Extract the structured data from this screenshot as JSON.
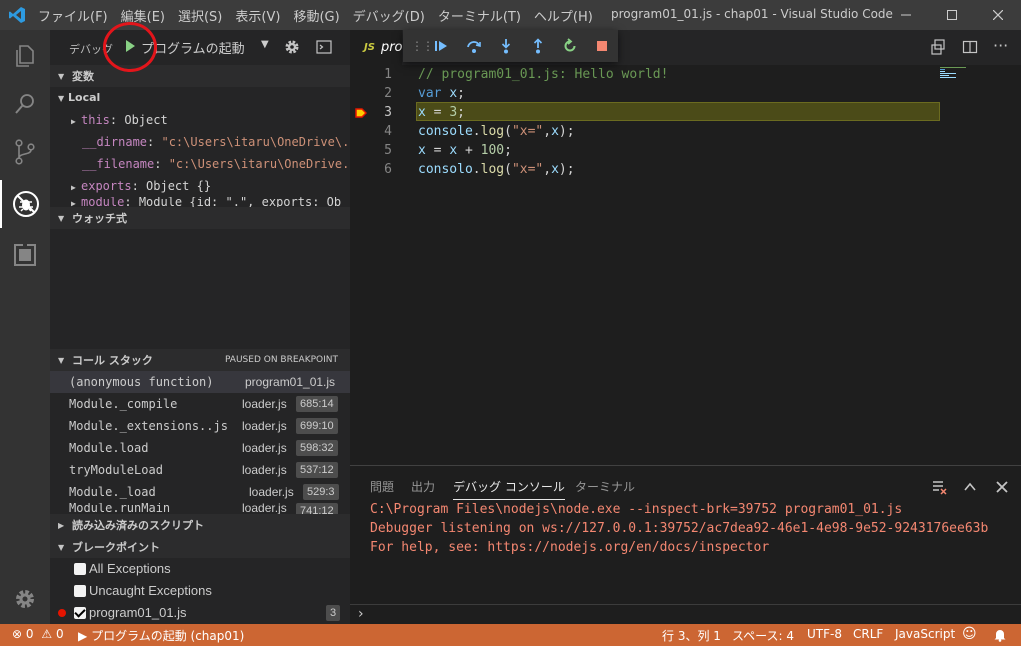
{
  "window": {
    "title": "program01_01.js - chap01 - Visual Studio Code",
    "menu": [
      "ファイル(F)",
      "編集(E)",
      "選択(S)",
      "表示(V)",
      "移動(G)",
      "デバッグ(D)",
      "ターミナル(T)",
      "ヘルプ(H)"
    ]
  },
  "debug_toolbar": {
    "label": "デバッグ",
    "config": "プログラムの起動"
  },
  "sections": {
    "variables": "変数",
    "local": "Local",
    "watch": "ウォッチ式",
    "call_stack": "コール スタック",
    "paused": "PAUSED ON BREAKPOINT",
    "loaded_scripts": "読み込み済みのスクリプト",
    "breakpoints": "ブレークポイント"
  },
  "variables": [
    {
      "key": "this",
      "value": "Object"
    },
    {
      "key": "__dirname",
      "value": "\"c:\\Users\\itaru\\OneDrive\\..."
    },
    {
      "key": "__filename",
      "value": "\"c:\\Users\\itaru\\OneDrive..."
    },
    {
      "key": "exports",
      "value": "Object {}"
    },
    {
      "key": "module",
      "value": "Module {id: \".\", exports: Ob"
    }
  ],
  "call_stack": [
    {
      "fn": "(anonymous function)",
      "file": "program01_01.js",
      "line": ""
    },
    {
      "fn": "Module._compile",
      "file": "loader.js",
      "line": "685:14"
    },
    {
      "fn": "Module._extensions..js",
      "file": "loader.js",
      "line": "699:10"
    },
    {
      "fn": "Module.load",
      "file": "loader.js",
      "line": "598:32"
    },
    {
      "fn": "tryModuleLoad",
      "file": "loader.js",
      "line": "537:12"
    },
    {
      "fn": "Module._load",
      "file": "loader.js",
      "line": "529:3"
    },
    {
      "fn": "Module.runMain",
      "file": "loader.js",
      "line": "741:12"
    }
  ],
  "breakpoints": [
    {
      "label": "All Exceptions",
      "checked": false
    },
    {
      "label": "Uncaught Exceptions",
      "checked": false
    },
    {
      "label": "program01_01.js",
      "checked": true,
      "count": "3"
    }
  ],
  "editor": {
    "tab_label": "program01_01.js",
    "tab_prefix": "JS",
    "lines": [
      {
        "n": "1",
        "text": "// program01_01.js: Hello world!"
      },
      {
        "n": "2",
        "text": "var x;"
      },
      {
        "n": "3",
        "text": "x = 3;"
      },
      {
        "n": "4",
        "text": "console.log(\"x=\",x);"
      },
      {
        "n": "5",
        "text": "x = x + 100;"
      },
      {
        "n": "6",
        "text": "consolo.log(\"x=\",x);"
      }
    ],
    "current_line": 3
  },
  "panel": {
    "tabs": [
      "問題",
      "出力",
      "デバッグ コンソール",
      "ターミナル"
    ],
    "active_tab": "デバッグ コンソール",
    "output": [
      "C:\\Program Files\\nodejs\\node.exe --inspect-brk=39752 program01_01.js",
      "Debugger listening on ws://127.0.0.1:39752/ac7dea92-46e1-4e98-9e52-9243176ee63b",
      "For help, see: https://nodejs.org/en/docs/inspector"
    ],
    "prompt": "›"
  },
  "statusbar": {
    "errors": "0",
    "warnings": "0",
    "debug_config": "プログラムの起動 (chap01)",
    "position": "行 3、列 1",
    "spaces": "スペース: 4",
    "encoding": "UTF-8",
    "eol": "CRLF",
    "language": "JavaScript"
  },
  "colors": {
    "statusbar": "#cc6633",
    "highlight": "#4b4b18",
    "annotation_circle": "#e3151b"
  }
}
